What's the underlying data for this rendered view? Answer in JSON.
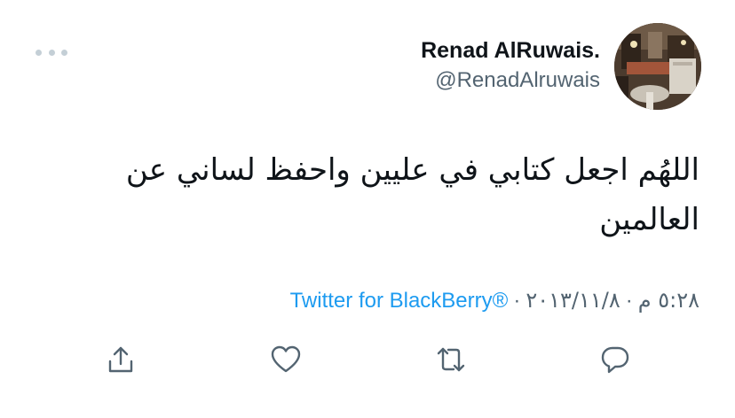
{
  "user": {
    "display_name": "Renad AlRuwais.",
    "handle": "@RenadAlruwais"
  },
  "tweet": {
    "text": "اللهُم اجعل كتابي في عليين واحفظ لساني عن العالمين",
    "date": "٢٠١٣/١١/٨",
    "time": "٥:٢٨ م",
    "source": "Twitter for BlackBerry®",
    "separator": "·"
  },
  "icons": {
    "more": "more-icon",
    "share": "share-icon",
    "like": "heart-icon",
    "retweet": "retweet-icon",
    "reply": "reply-icon"
  },
  "colors": {
    "link": "#1d9bf0",
    "secondary_text": "#536471",
    "primary_text": "#0f1419"
  }
}
